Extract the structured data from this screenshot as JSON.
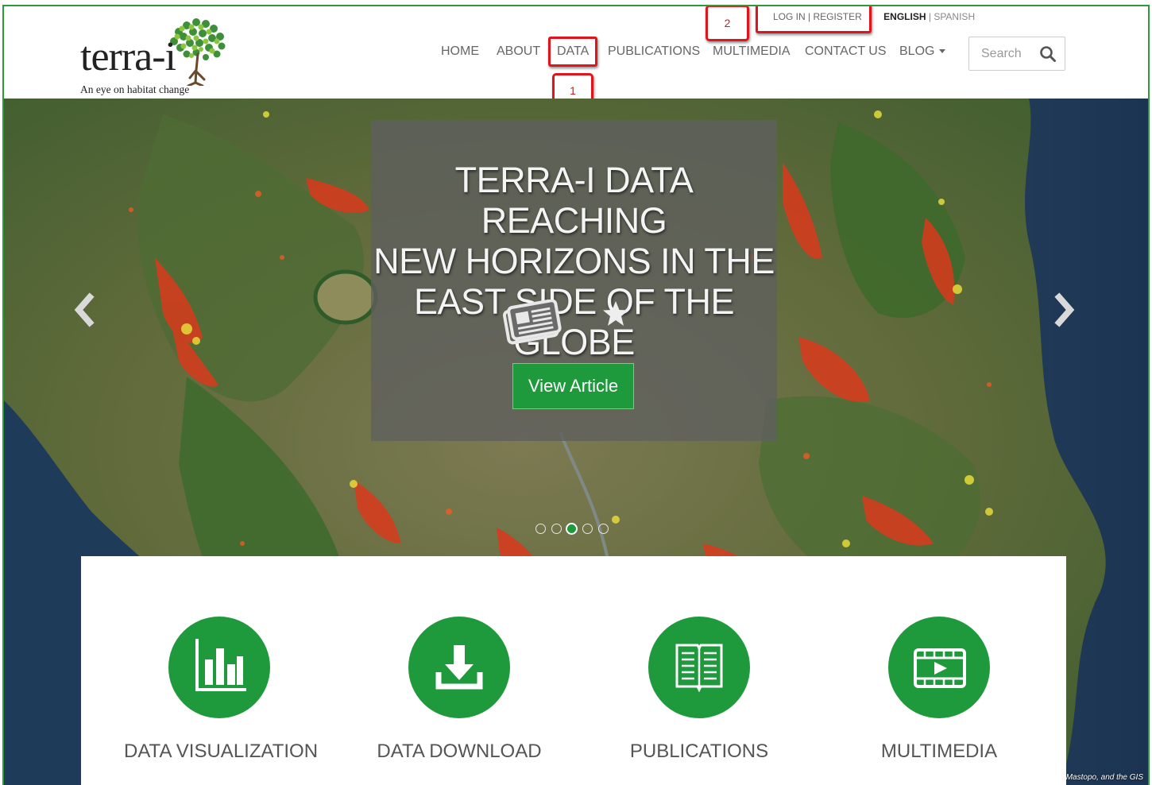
{
  "header": {
    "logo_text": "terra-i",
    "logo_tagline": "An eye on habitat change",
    "login_label": "LOG IN | REGISTER",
    "lang_english": "ENGLISH",
    "lang_separator": "|",
    "lang_spanish": "SPANISH",
    "nav": [
      {
        "label": "HOME"
      },
      {
        "label": "ABOUT"
      },
      {
        "label": "DATA"
      },
      {
        "label": "PUBLICATIONS"
      },
      {
        "label": "MULTIMEDIA"
      },
      {
        "label": "CONTACT US"
      },
      {
        "label": "BLOG",
        "icon": "caret-down-icon"
      }
    ],
    "search": {
      "placeholder": "Search",
      "icon": "search-icon"
    }
  },
  "annotations": [
    {
      "number": "1",
      "target": "DATA"
    },
    {
      "number": "2",
      "target": "LOG IN | REGISTER"
    }
  ],
  "hero": {
    "title_lines": [
      "TERRA-I DATA REACHING",
      "NEW HORIZONS IN THE",
      "EAST SIDE OF THE GLOBE"
    ],
    "icons": [
      "newspaper-icon",
      "star-icon"
    ],
    "button_label": "View Article",
    "slides_total": 5,
    "slide_active": 3,
    "attribution": "Mastopo, and the GIS"
  },
  "features": [
    {
      "label": "DATA VISUALIZATION",
      "icon": "bar-chart-icon"
    },
    {
      "label": "DATA DOWNLOAD",
      "icon": "download-icon"
    },
    {
      "label": "PUBLICATIONS",
      "icon": "book-icon"
    },
    {
      "label": "MULTIMEDIA",
      "icon": "video-icon"
    }
  ],
  "colors": {
    "brand_green": "#1e9a3c",
    "frame_green": "#2e9b3a",
    "annotation_red": "#e0141c",
    "nav_text": "#666666"
  }
}
